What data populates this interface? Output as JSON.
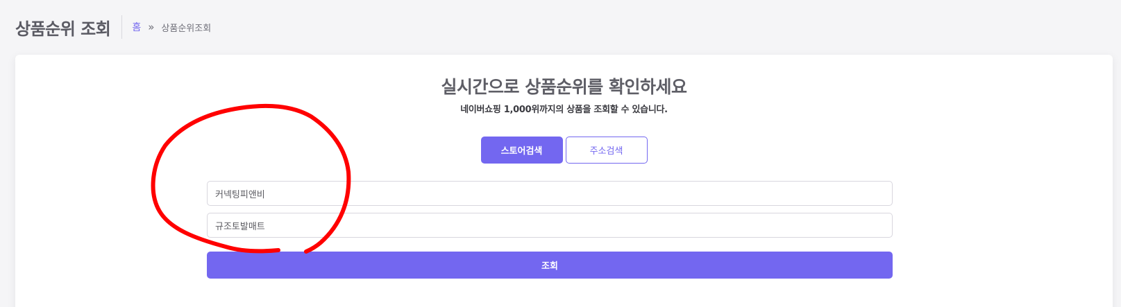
{
  "header": {
    "title": "상품순위 조회",
    "breadcrumb": {
      "home": "홈",
      "separator": "»",
      "current": "상품순위조회"
    }
  },
  "card": {
    "heading": "실시간으로 상품순위를 확인하세요",
    "subheading": "네이버쇼핑 1,000위까지의 상품을 조회할 수 있습니다.",
    "tabs": [
      {
        "label": "스토어검색",
        "active": true
      },
      {
        "label": "주소검색",
        "active": false
      }
    ],
    "store_field": {
      "value": "커넥팅피앤비"
    },
    "keyword_field": {
      "value": "규조토발매트"
    },
    "submit_label": "조회"
  },
  "colors": {
    "accent": "#7367f0",
    "annotation": "#ff0000",
    "background": "#f5f5f7"
  }
}
